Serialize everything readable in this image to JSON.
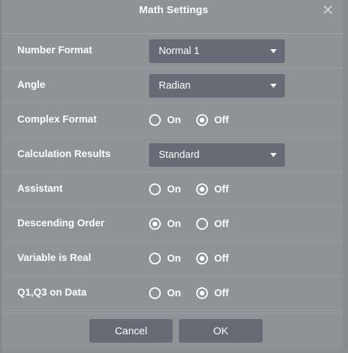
{
  "dialog": {
    "title": "Math Settings",
    "close_icon": "close-icon"
  },
  "rows": [
    {
      "label": "Number Format",
      "type": "dropdown",
      "value": "Normal 1",
      "caret_icon": "chevron-down-icon"
    },
    {
      "label": "Angle",
      "type": "dropdown",
      "value": "Radian",
      "caret_icon": "chevron-down-icon"
    },
    {
      "label": "Complex Format",
      "type": "radio",
      "on_label": "On",
      "off_label": "Off",
      "selected": "Off"
    },
    {
      "label": "Calculation Results",
      "type": "dropdown",
      "value": "Standard",
      "caret_icon": "chevron-down-icon"
    },
    {
      "label": "Assistant",
      "type": "radio",
      "on_label": "On",
      "off_label": "Off",
      "selected": "Off"
    },
    {
      "label": "Descending Order",
      "type": "radio",
      "on_label": "On",
      "off_label": "Off",
      "selected": "On"
    },
    {
      "label": "Variable is Real",
      "type": "radio",
      "on_label": "On",
      "off_label": "Off",
      "selected": "Off"
    },
    {
      "label": "Q1,Q3 on Data",
      "type": "radio",
      "on_label": "On",
      "off_label": "Off",
      "selected": "Off"
    }
  ],
  "footer": {
    "cancel_label": "Cancel",
    "ok_label": "OK"
  },
  "colors": {
    "dialog_background": "#8f9396",
    "control_background": "#666b76",
    "text": "#ffffff",
    "separator": "#9a9ea1",
    "scrollbar_track": "#878b8e"
  }
}
